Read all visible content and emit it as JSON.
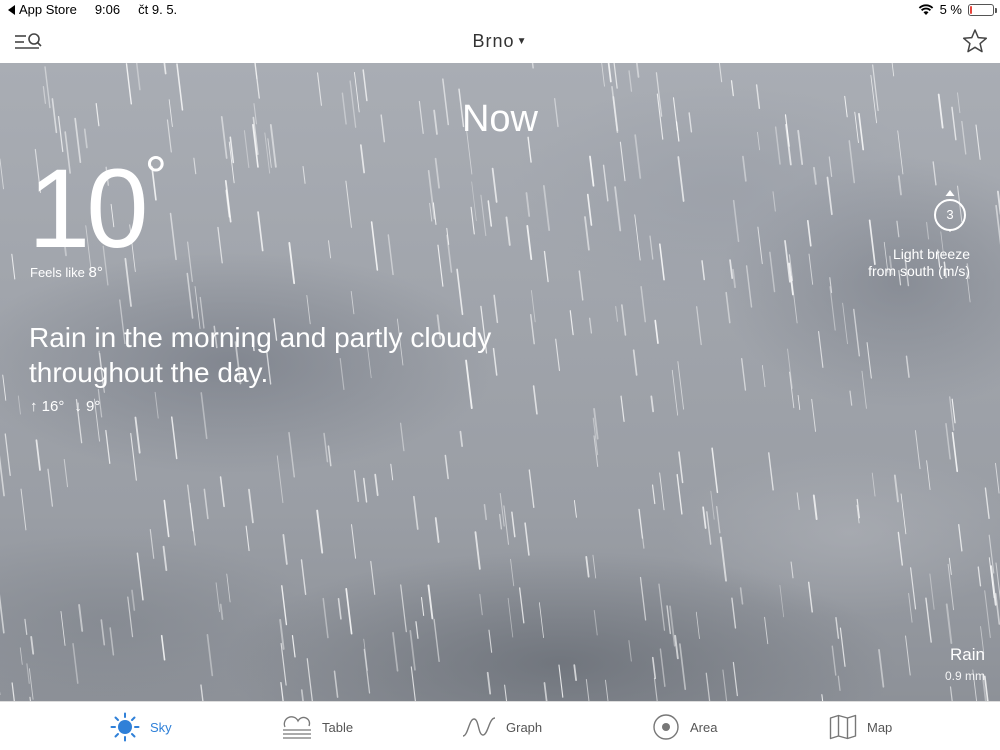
{
  "status_bar": {
    "back_label": "App Store",
    "time": "9:06",
    "date": "čt 9. 5.",
    "battery_percent": "5 %",
    "battery_level": 0.05
  },
  "header": {
    "city": "Brno"
  },
  "sky": {
    "title": "Now",
    "temperature": "10",
    "temperature_unit": "°",
    "feels_like_label": "Feels like",
    "feels_like_value": "8°",
    "summary": "Rain in the morning and partly cloudy throughout the day.",
    "max_temp": "16°",
    "min_temp": "9°",
    "wind": {
      "speed": "3",
      "label_line1": "Light breeze",
      "label_line2": "from south (m/s)"
    },
    "precipitation": {
      "label": "Rain",
      "amount": "0.9 mm"
    }
  },
  "tabs": [
    {
      "label": "Sky",
      "icon": "sun-icon",
      "active": true
    },
    {
      "label": "Table",
      "icon": "cloud-table-icon",
      "active": false
    },
    {
      "label": "Graph",
      "icon": "wave-graph-icon",
      "active": false
    },
    {
      "label": "Area",
      "icon": "target-area-icon",
      "active": false
    },
    {
      "label": "Map",
      "icon": "map-icon",
      "active": false
    }
  ],
  "colors": {
    "accent": "#2f80d8",
    "tab_inactive": "#555555",
    "battery_low": "#e8453c"
  }
}
